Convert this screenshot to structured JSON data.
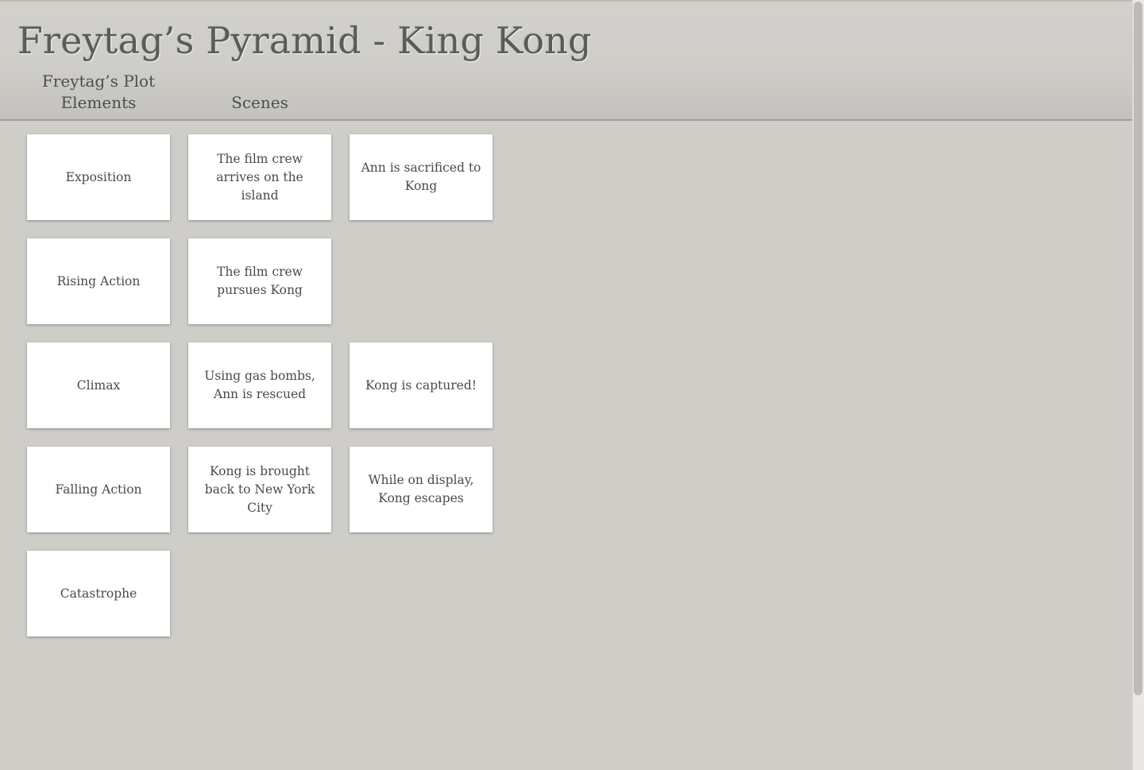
{
  "header": {
    "title": "Freytag’s Pyramid - King Kong",
    "columns": {
      "plot_elements": "Freytag’s Plot Elements",
      "scenes": "Scenes"
    }
  },
  "rows": [
    {
      "element": "Exposition",
      "scenes": [
        "The film crew arrives on the island",
        "Ann is sacrificed to Kong"
      ]
    },
    {
      "element": "Rising Action",
      "scenes": [
        "The film crew pursues Kong"
      ]
    },
    {
      "element": "Climax",
      "scenes": [
        "Using gas bombs, Ann is rescued",
        "Kong is captured!"
      ]
    },
    {
      "element": "Falling Action",
      "scenes": [
        "Kong is brought back to New York City",
        "While on display, Kong escapes"
      ]
    },
    {
      "element": "Catastrophe",
      "scenes": []
    }
  ],
  "colors": {
    "background": "#cfcdc8",
    "card": "#ffffff",
    "text": "#4a4a4a"
  }
}
